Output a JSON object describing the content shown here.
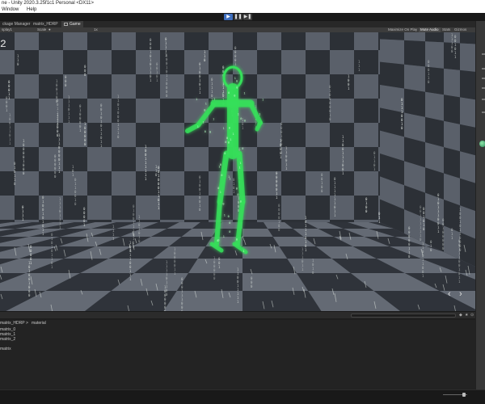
{
  "window": {
    "title": "ne - Unity 2020.3.25f1c1 Personal <DX11>"
  },
  "menu": {
    "items": [
      "Window",
      "Help"
    ]
  },
  "toolbar": {
    "play_icon": "play-icon",
    "pause_icon": "pause-icon",
    "step_icon": "step-icon",
    "play_glyph": "▶",
    "pause_glyph": "❚❚",
    "step_glyph": "▶❚",
    "accent_color": "#3f6fbf"
  },
  "tabs": {
    "package_manager": "ckage Manager",
    "matrix_hdrp": "matrix_HDRP",
    "game": "Game"
  },
  "gamebar": {
    "display": "splay1",
    "scale_label": "Scale",
    "scale_dot": "●",
    "scale_value": "1x",
    "maximize": "Maximize On Play",
    "mute": "Mute Audio",
    "stats": "Stats",
    "gizmos": "Gizmos"
  },
  "viewport": {
    "fps_text": "2",
    "prev_glyph": "‹",
    "next_glyph": "›",
    "figure_color": "#35e05a",
    "rain_color": "#e6ece6",
    "rain_glyphs": [
      "0",
      "1"
    ]
  },
  "project": {
    "breadcrumb_root": "matrix_HDRP",
    "breadcrumb_sep": ">",
    "breadcrumb_leaf": "material",
    "items": [
      "matrix_0",
      "matrix_1",
      "matrix_2",
      "matrix"
    ]
  },
  "bottom_bar": {
    "icon_a": "◆",
    "icon_b": "★",
    "icon_c": "⊙"
  }
}
